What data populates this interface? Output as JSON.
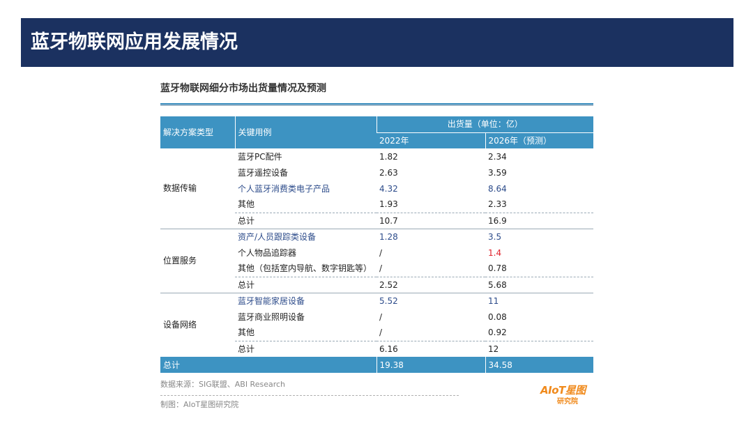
{
  "header": {
    "title": "蓝牙物联网应用发展情况"
  },
  "table_title": "蓝牙物联网细分市场出货量情况及预测",
  "columns": {
    "solution": "解决方案类型",
    "use_case": "关键用例",
    "shipments": "出货量（单位：亿）",
    "year_a": "2022年",
    "year_b": "2026年（预测）"
  },
  "groups": [
    {
      "name": "数据传输",
      "rows": [
        {
          "label": "蓝牙PC配件",
          "a": "1.82",
          "b": "2.34"
        },
        {
          "label": "蓝牙遥控设备",
          "a": "2.63",
          "b": "3.59"
        },
        {
          "label": "个人蓝牙消费类电子产品",
          "a": "4.32",
          "b": "8.64"
        },
        {
          "label": "其他",
          "a": "1.93",
          "b": "2.33"
        },
        {
          "label": "总计",
          "a": "10.7",
          "b": "16.9"
        }
      ]
    },
    {
      "name": "位置服务",
      "rows": [
        {
          "label": "资产/人员跟踪类设备",
          "a": "1.28",
          "b": "3.5"
        },
        {
          "label": "个人物品追踪器",
          "a": "/",
          "b": "1.4"
        },
        {
          "label": "其他（包括室内导航、数字钥匙等）",
          "a": "/",
          "b": "0.78"
        },
        {
          "label": "总计",
          "a": "2.52",
          "b": "5.68"
        }
      ]
    },
    {
      "name": "设备网络",
      "rows": [
        {
          "label": "蓝牙智能家居设备",
          "a": "5.52",
          "b": "11"
        },
        {
          "label": "蓝牙商业照明设备",
          "a": "/",
          "b": "0.08"
        },
        {
          "label": "其他",
          "a": "/",
          "b": "0.92"
        },
        {
          "label": "总计",
          "a": "6.16",
          "b": "12"
        }
      ]
    }
  ],
  "grand_total": {
    "label": "总计",
    "a": "19.38",
    "b": "34.58"
  },
  "source": "数据来源：SIG联盟、ABI Research",
  "credit": "制图：AIoT星图研究院",
  "logo": {
    "main": "AIoT星图",
    "sub": "研究院"
  },
  "colors": {
    "title_bar": "#1b3160",
    "table_header": "#3d93c2",
    "highlight_text": "#2c4b8a",
    "alert_text": "#e0202a",
    "logo": "#f08a1c"
  }
}
